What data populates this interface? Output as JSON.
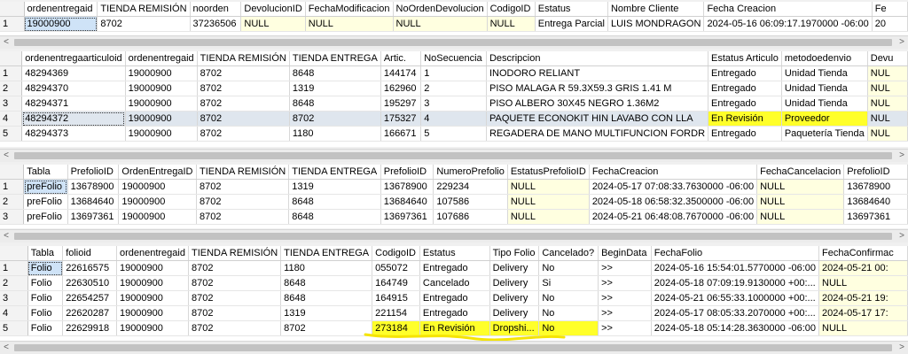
{
  "grid1": {
    "columns": [
      "",
      "ordenentregaid",
      "TIENDA REMISIÓN",
      "noorden",
      "DevolucionID",
      "FechaModificacion",
      "NoOrdenDevolucion",
      "CodigoID",
      "Estatus",
      "Nombre Cliente",
      "Fecha Creacion",
      "Fe"
    ],
    "rows": [
      [
        "1",
        "19000900",
        "8702",
        "37236506",
        "NULL",
        "NULL",
        "NULL",
        "NULL",
        "Entrega Parcial",
        "LUIS MONDRAGON",
        "2024-05-16 06:09:17.1970000 -06:00",
        "20"
      ]
    ]
  },
  "grid2": {
    "columns": [
      "",
      "ordenentregaarticuloid",
      "ordenentregaid",
      "TIENDA REMISIÓN",
      "TIENDA ENTREGA",
      "Artic.",
      "NoSecuencia",
      "Descripcion",
      "Estatus Articulo",
      "metodoedenvio",
      "Devu"
    ],
    "rows": [
      [
        "1",
        "48294369",
        "19000900",
        "8702",
        "8648",
        "144174",
        "1",
        "INODORO RELIANT",
        "Entregado",
        "Unidad Tienda",
        "NUL"
      ],
      [
        "2",
        "48294370",
        "19000900",
        "8702",
        "1319",
        "162960",
        "2",
        "PISO MALAGA R 59.3X59.3 GRIS 1.41 M",
        "Entregado",
        "Unidad Tienda",
        "NUL"
      ],
      [
        "3",
        "48294371",
        "19000900",
        "8702",
        "8648",
        "195297",
        "3",
        "PISO ALBERO 30X45 NEGRO 1.36M2",
        "Entregado",
        "Unidad Tienda",
        "NUL"
      ],
      [
        "4",
        "48294372",
        "19000900",
        "8702",
        "8702",
        "175327",
        "4",
        "PAQUETE ECONOKIT HIN LAVABO CON LLA",
        "En Revisión",
        "Proveedor",
        "NUL"
      ],
      [
        "5",
        "48294373",
        "19000900",
        "8702",
        "1180",
        "166671",
        "5",
        "REGADERA DE MANO MULTIFUNCION FORDR",
        "Entregado",
        "Paquetería Tienda",
        "NUL"
      ]
    ]
  },
  "grid3": {
    "columns": [
      "",
      "Tabla",
      "PrefolioID",
      "OrdenEntregaID",
      "TIENDA REMISIÓN",
      "TIENDA ENTREGA",
      "PrefolioID",
      "NumeroPrefolio",
      "EstatusPrefolioID",
      "FechaCreacion",
      "FechaCancelacion",
      "PrefolioID"
    ],
    "rows": [
      [
        "1",
        "preFolio",
        "13678900",
        "19000900",
        "8702",
        "1319",
        "13678900",
        "229234",
        "NULL",
        "2024-05-17 07:08:33.7630000 -06:00",
        "NULL",
        "13678900"
      ],
      [
        "2",
        "preFolio",
        "13684640",
        "19000900",
        "8702",
        "8648",
        "13684640",
        "107586",
        "NULL",
        "2024-05-18 06:58:32.3500000 -06:00",
        "NULL",
        "13684640"
      ],
      [
        "3",
        "preFolio",
        "13697361",
        "19000900",
        "8702",
        "8648",
        "13697361",
        "107686",
        "NULL",
        "2024-05-21 06:48:08.7670000 -06:00",
        "NULL",
        "13697361"
      ]
    ]
  },
  "grid4": {
    "columns": [
      "",
      "Tabla",
      "folioid",
      "ordenentregaid",
      "TIENDA REMISIÓN",
      "TIENDA ENTREGA",
      "CodigoID",
      "Estatus",
      "Tipo Folio",
      "Cancelado?",
      "BeginData",
      "FechaFolio",
      "FechaConfirmac"
    ],
    "rows": [
      [
        "1",
        "Folio",
        "22616575",
        "19000900",
        "8702",
        "1180",
        "055072",
        "Entregado",
        "Delivery",
        "No",
        ">>",
        "2024-05-16 15:54:01.5770000 -06:00",
        "2024-05-21 00:"
      ],
      [
        "2",
        "Folio",
        "22630510",
        "19000900",
        "8702",
        "8648",
        "164749",
        "Cancelado",
        "Delivery",
        "Si",
        ">>",
        "2024-05-18 07:09:19.9130000 +00:...",
        "NULL"
      ],
      [
        "3",
        "Folio",
        "22654257",
        "19000900",
        "8702",
        "8648",
        "164915",
        "Entregado",
        "Delivery",
        "No",
        ">>",
        "2024-05-21 06:55:33.1000000 +00:...",
        "2024-05-21 19:"
      ],
      [
        "4",
        "Folio",
        "22620287",
        "19000900",
        "8702",
        "1319",
        "221154",
        "Entregado",
        "Delivery",
        "No",
        ">>",
        "2024-05-17 08:05:33.2070000 +00:...",
        "2024-05-17 17:"
      ],
      [
        "5",
        "Folio",
        "22629918",
        "19000900",
        "8702",
        "8702",
        "273184",
        "En Revisión",
        "Dropshi...",
        "No",
        ">>",
        "2024-05-18 05:14:28.3630000 -06:00",
        "NULL"
      ]
    ]
  },
  "scroll_arrows": {
    "left": "<",
    "right": ">"
  },
  "colors": {
    "highlight": "#ffff2a",
    "null_cell": "#ffffe0",
    "squiggle": "#f5e400"
  }
}
